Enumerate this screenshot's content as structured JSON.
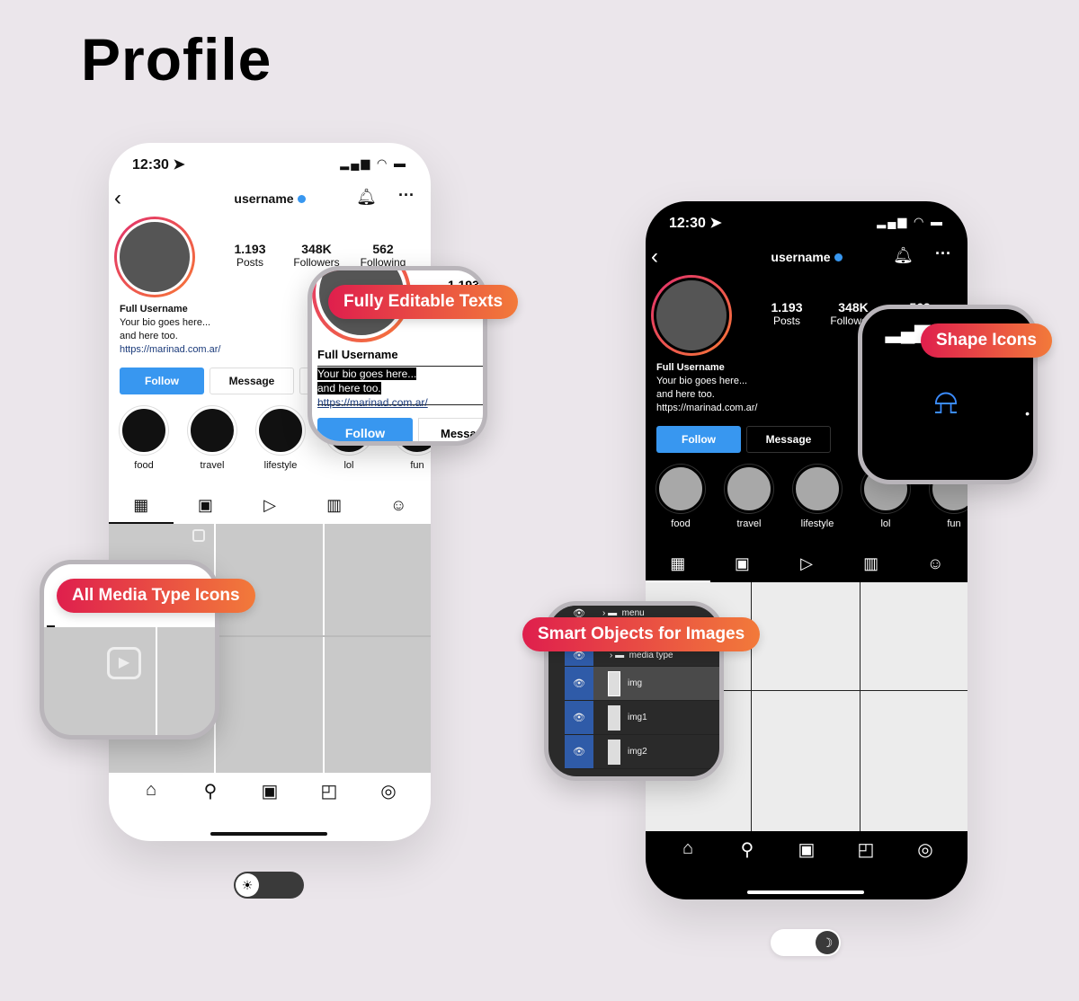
{
  "page_title": "Profile",
  "phone": {
    "time": "12:30",
    "status_icons": "signal wifi battery",
    "username": "username",
    "stats": [
      {
        "value": "1.193",
        "label": "Posts"
      },
      {
        "value": "348K",
        "label": "Followers"
      },
      {
        "value": "562",
        "label": "Following"
      }
    ],
    "full_name": "Full Username",
    "bio_line1": "Your bio goes here...",
    "bio_line2": "and here too.",
    "link": "https://marinad.com.ar/",
    "follow_label": "Follow",
    "message_label": "Message",
    "highlights": [
      "food",
      "travel",
      "lifestyle",
      "lol",
      "fun"
    ],
    "tab_icons": [
      "grid-icon",
      "reels-icon",
      "video-icon",
      "guide-icon",
      "tagged-icon"
    ],
    "nav_icons": [
      "home-icon",
      "search-icon",
      "reels-icon",
      "shop-icon",
      "profile-icon"
    ]
  },
  "callouts": {
    "editable": "Fully Editable Texts",
    "media": "All Media Type Icons",
    "shape": "Shape Icons",
    "smart": "Smart Objects for Images"
  },
  "zoom_editable": {
    "stat": "1.193",
    "full_name": "Full Username",
    "bio_line1": "Your bio goes here...",
    "bio_line2": "and here too.",
    "link": "https://marinad.com.ar/",
    "follow": "Follow",
    "message": "Messag"
  },
  "zoom_dark": {
    "stat_followers": "348K",
    "stat_followers_label": "Followe",
    "stat_following": "562"
  },
  "layers": [
    {
      "name": "menu",
      "type": "folder"
    },
    {
      "name": "media type",
      "type": "folder"
    },
    {
      "name": "img",
      "type": "smart-object",
      "selected": true
    },
    {
      "name": "img1",
      "type": "smart-object"
    },
    {
      "name": "img2",
      "type": "smart-object"
    }
  ],
  "theme_toggle": {
    "light": "sun-icon",
    "dark": "moon-icon"
  },
  "colors": {
    "accent": "#3897f0",
    "pill_start": "#df1f4d",
    "pill_end": "#f27a3a",
    "background": "#ebe6eb"
  }
}
